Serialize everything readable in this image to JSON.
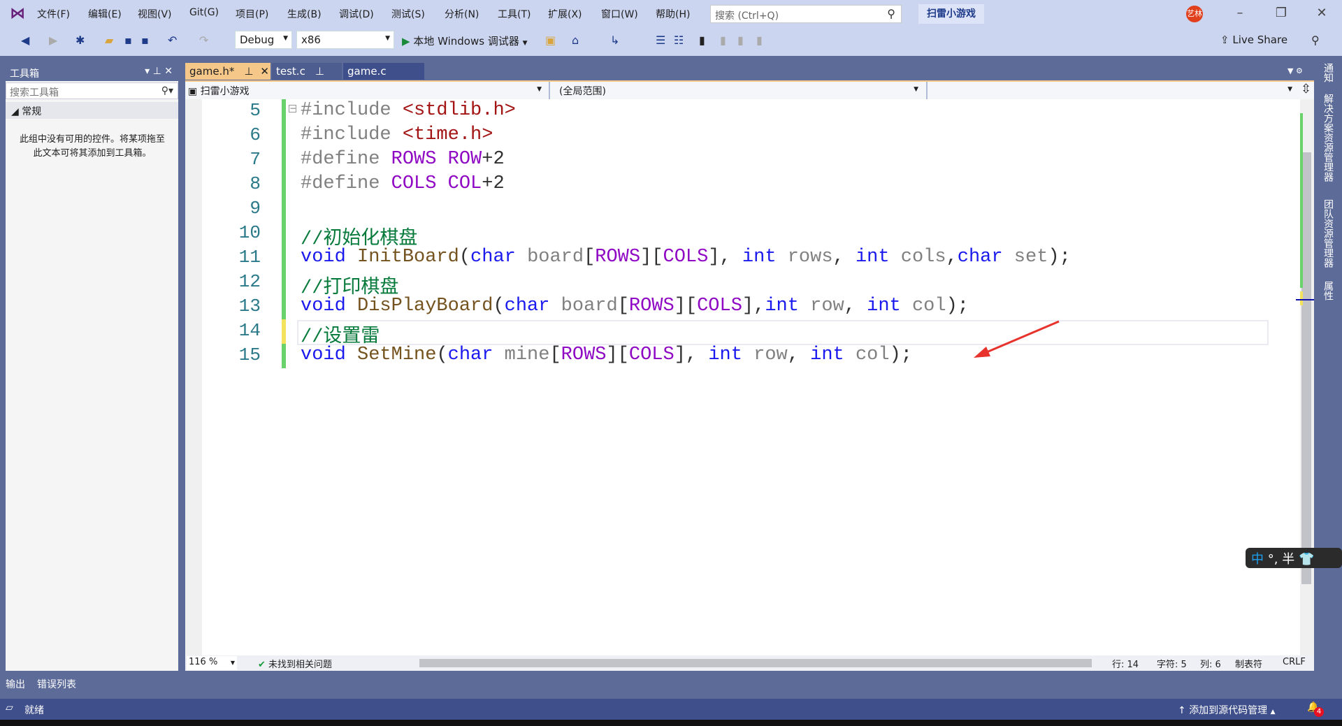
{
  "titlebar": {
    "menus": [
      "文件(F)",
      "编辑(E)",
      "视图(V)",
      "Git(G)",
      "项目(P)",
      "生成(B)",
      "调试(D)",
      "测试(S)",
      "分析(N)",
      "工具(T)",
      "扩展(X)",
      "窗口(W)",
      "帮助(H)"
    ],
    "search_placeholder": "搜索 (Ctrl+Q)",
    "solution_name": "扫雷小游戏",
    "avatar_text": "艺林"
  },
  "toolbar": {
    "config": "Debug",
    "platform": "x86",
    "run_label": "本地 Windows 调试器",
    "live_share": "Live Share"
  },
  "toolbox": {
    "title": "工具箱",
    "search_placeholder": "搜索工具箱",
    "group": "常规",
    "empty_message": "此组中没有可用的控件。将某项拖至此文本可将其添加到工具箱。"
  },
  "tabs": [
    {
      "label": "game.h*",
      "active": true
    },
    {
      "label": "test.c",
      "active": false
    },
    {
      "label": "game.c",
      "active": false
    }
  ],
  "navbar": {
    "project": "扫雷小游戏",
    "scope": "(全局范围)",
    "member": ""
  },
  "code": [
    {
      "n": "5",
      "change": "saved",
      "tokens": [
        [
          "d",
          "#include "
        ],
        [
          "s",
          "<stdlib.h>"
        ]
      ]
    },
    {
      "n": "6",
      "change": "saved",
      "tokens": [
        [
          "d",
          "#include "
        ],
        [
          "s",
          "<time.h>"
        ]
      ]
    },
    {
      "n": "7",
      "change": "saved",
      "tokens": [
        [
          "d",
          "#define "
        ],
        [
          "m",
          "ROWS "
        ],
        [
          "m",
          "ROW"
        ],
        [
          "t",
          "+2"
        ]
      ]
    },
    {
      "n": "8",
      "change": "saved",
      "tokens": [
        [
          "d",
          "#define "
        ],
        [
          "m",
          "COLS "
        ],
        [
          "m",
          "COL"
        ],
        [
          "t",
          "+2"
        ]
      ]
    },
    {
      "n": "9",
      "change": "saved",
      "tokens": []
    },
    {
      "n": "10",
      "change": "saved",
      "tokens": [
        [
          "c",
          "//初始化棋盘"
        ]
      ]
    },
    {
      "n": "11",
      "change": "saved",
      "tokens": [
        [
          "k",
          "void "
        ],
        [
          "f",
          "InitBoard"
        ],
        [
          "t",
          "("
        ],
        [
          "k",
          "char "
        ],
        [
          "p",
          "board"
        ],
        [
          "t",
          "["
        ],
        [
          "m",
          "ROWS"
        ],
        [
          "t",
          "]["
        ],
        [
          "m",
          "COLS"
        ],
        [
          "t",
          "], "
        ],
        [
          "k",
          "int "
        ],
        [
          "p",
          "rows"
        ],
        [
          "t",
          ", "
        ],
        [
          "k",
          "int "
        ],
        [
          "p",
          "cols"
        ],
        [
          "t",
          ","
        ],
        [
          "k",
          "char "
        ],
        [
          "p",
          "set"
        ],
        [
          "t",
          ");"
        ]
      ]
    },
    {
      "n": "12",
      "change": "saved",
      "tokens": [
        [
          "c",
          "//打印棋盘"
        ]
      ]
    },
    {
      "n": "13",
      "change": "saved",
      "tokens": [
        [
          "k",
          "void "
        ],
        [
          "f",
          "DisPlayBoard"
        ],
        [
          "t",
          "("
        ],
        [
          "k",
          "char "
        ],
        [
          "p",
          "board"
        ],
        [
          "t",
          "["
        ],
        [
          "m",
          "ROWS"
        ],
        [
          "t",
          "]["
        ],
        [
          "m",
          "COLS"
        ],
        [
          "t",
          "],"
        ],
        [
          "k",
          "int "
        ],
        [
          "p",
          "row"
        ],
        [
          "t",
          ", "
        ],
        [
          "k",
          "int "
        ],
        [
          "p",
          "col"
        ],
        [
          "t",
          ");"
        ]
      ]
    },
    {
      "n": "14",
      "change": "unsaved",
      "tokens": [
        [
          "c",
          "//设置雷"
        ]
      ]
    },
    {
      "n": "15",
      "change": "saved",
      "tokens": [
        [
          "k",
          "void "
        ],
        [
          "f",
          "SetMine"
        ],
        [
          "t",
          "("
        ],
        [
          "k",
          "char "
        ],
        [
          "p",
          "mine"
        ],
        [
          "t",
          "["
        ],
        [
          "m",
          "ROWS"
        ],
        [
          "t",
          "]["
        ],
        [
          "m",
          "COLS"
        ],
        [
          "t",
          "], "
        ],
        [
          "k",
          "int "
        ],
        [
          "p",
          "row"
        ],
        [
          "t",
          ", "
        ],
        [
          "k",
          "int "
        ],
        [
          "p",
          "col"
        ],
        [
          "t",
          ");"
        ]
      ]
    }
  ],
  "editor_status": {
    "zoom": "116 %",
    "issues": "未找到相关问题",
    "line": "行: 14",
    "char": "字符: 5",
    "col": "列: 6",
    "indent": "制表符",
    "eol": "CRLF"
  },
  "right_tabs": [
    "通知",
    "解决方案资源管理器",
    "团队资源管理器",
    "属性"
  ],
  "bottom_tabs": [
    "输出",
    "错误列表"
  ],
  "statusbar": {
    "ready": "就绪",
    "source_control": "添加到源代码管理",
    "notifications": "4"
  },
  "ime": {
    "mode": "中",
    "punct": "°,",
    "width": "半"
  },
  "colors": {
    "chrome": "#ccd5f0",
    "panel": "#5d6b99",
    "statusbar": "#3f4f8b",
    "active_tab": "#f5c88a",
    "saved_change": "#6ad26a",
    "unsaved_change": "#f3e25c",
    "annotation_arrow": "#e8322c"
  }
}
